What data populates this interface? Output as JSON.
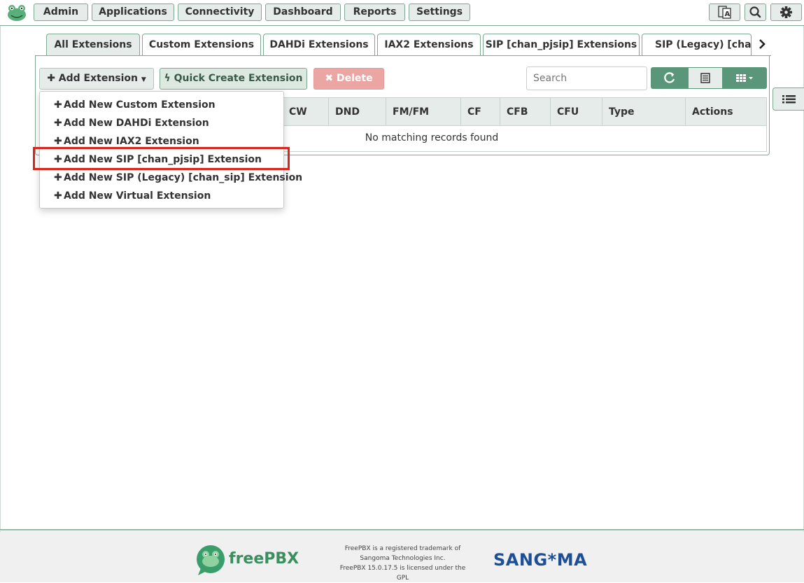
{
  "nav": {
    "items": [
      "Admin",
      "Applications",
      "Connectivity",
      "Dashboard",
      "Reports",
      "Settings"
    ]
  },
  "tabs": [
    "All Extensions",
    "Custom Extensions",
    "DAHDi Extensions",
    "IAX2 Extensions",
    "SIP [chan_pjsip] Extensions",
    "SIP (Legacy) [chan_sip] Extensions"
  ],
  "toolbar": {
    "add_extension": "Add Extension",
    "quick_create": "Quick Create Extension",
    "delete": "Delete",
    "search_placeholder": "Search"
  },
  "table": {
    "headers": [
      "CW",
      "DND",
      "FM/FM",
      "CF",
      "CFB",
      "CFU",
      "Type",
      "Actions"
    ],
    "empty_message": "No matching records found"
  },
  "dropdown": {
    "items": [
      "Add New Custom Extension",
      "Add New DAHDi Extension",
      "Add New IAX2 Extension",
      "Add New SIP [chan_pjsip] Extension",
      "Add New SIP (Legacy) [chan_sip] Extension",
      "Add New Virtual Extension"
    ],
    "highlighted_index": 3
  },
  "footer": {
    "brand": "freePBX",
    "legal_lines": [
      "FreePBX is a registered trademark of",
      "Sangoma Technologies Inc.",
      "FreePBX 15.0.17.5 is licensed under the",
      "GPL"
    ],
    "sangoma": "SANG*MA"
  },
  "colors": {
    "accent": "#5a977a",
    "border": "#7fa893",
    "highlight_box": "#d9261c",
    "delete_bg": "#eba5a3",
    "sangoma_blue": "#1d4f96",
    "freepbx_green": "#3a8f5e"
  }
}
